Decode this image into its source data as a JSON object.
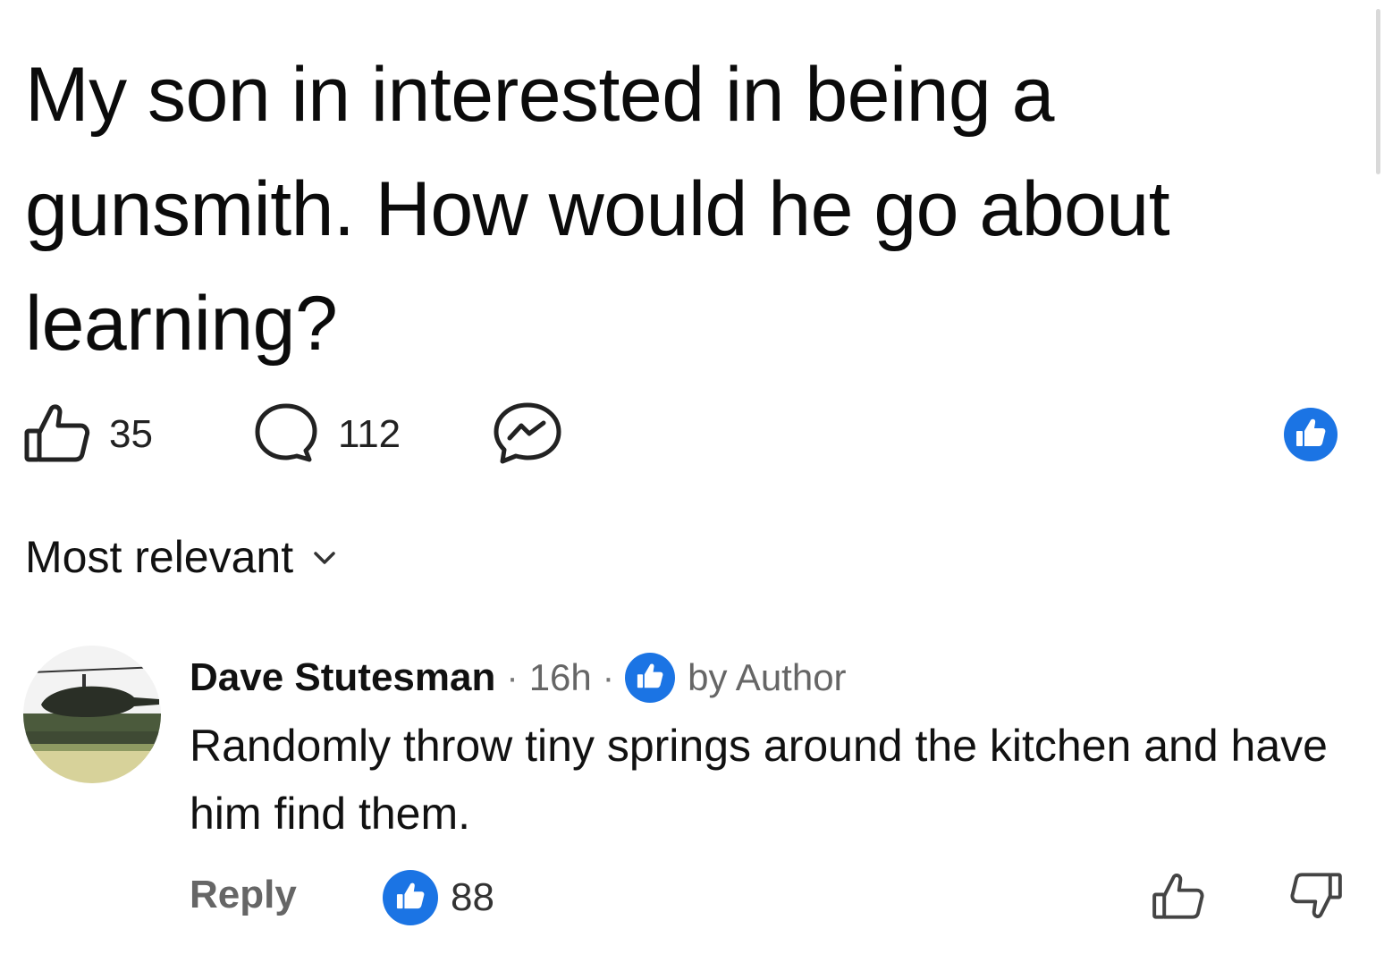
{
  "post": {
    "title": "My son in interested in being a gunsmith. How would he go about learning?",
    "like_count": "35",
    "comment_count": "112"
  },
  "icons": {
    "like": "thumbs-up-outline-icon",
    "comment": "speech-bubble-icon",
    "share": "messenger-icon",
    "reaction": "thumbs-up-filled-icon",
    "sort": "chevron-down-icon",
    "upvote": "thumbs-up-outline-icon",
    "downvote": "thumbs-down-outline-icon"
  },
  "sort": {
    "label": "Most relevant"
  },
  "comment": {
    "author": "Dave Stutesman",
    "separator": "·",
    "time": "16h",
    "liked_by": "by Author",
    "text": "Randomly throw tiny springs around the kitchen and have him find them.",
    "reply_label": "Reply",
    "like_count": "88"
  },
  "colors": {
    "accent": "#1b74e4",
    "text": "#111111",
    "muted": "#666666",
    "background": "#ffffff"
  }
}
